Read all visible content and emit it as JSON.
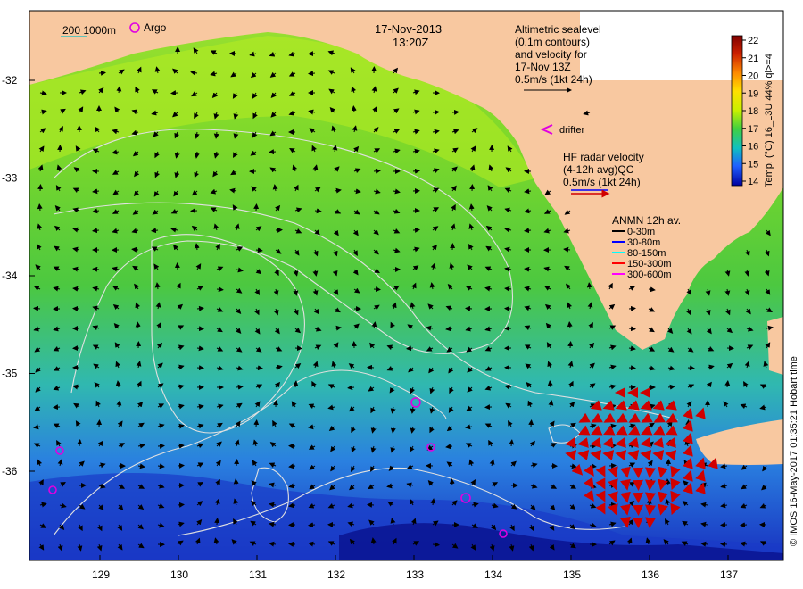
{
  "map": {
    "date": "17-Nov-2013",
    "time": "13:20Z",
    "scale_bar_label": "200  1000m",
    "argo_label": "Argo",
    "altimetry_text": [
      "Altimetric sealevel",
      "(0.1m contours)",
      "and velocity for",
      "17-Nov 13Z",
      "0.5m/s (1kt 24h)"
    ],
    "drifter_label": "drifter",
    "hf_text": [
      "HF radar velocity",
      "(4-12h avg)QC",
      "0.5m/s (1kt 24h)"
    ],
    "anmn_title": "ANMN 12h av.",
    "anmn_items": [
      {
        "label": "0-30m",
        "color": "#000000"
      },
      {
        "label": "30-80m",
        "color": "#0000ff"
      },
      {
        "label": "80-150m",
        "color": "#00ffff"
      },
      {
        "label": "150-300m",
        "color": "#ff0000"
      },
      {
        "label": "300-600m",
        "color": "#ff00ff"
      }
    ],
    "colorbar": {
      "ticks": [
        "22",
        "21",
        "20",
        "19",
        "18",
        "17",
        "16",
        "15",
        "14"
      ],
      "label": "Temp. (°C) 16_L3U 44% ql>=4",
      "stops": [
        "#7f0000",
        "#cc2000",
        "#ff8c00",
        "#ffe000",
        "#c8f000",
        "#40d040",
        "#10c0c0",
        "#2060ff",
        "#0000a0"
      ]
    },
    "credit": "© IMOS 16-May-2017 01:35:21 Hobart time",
    "x_ticks": [
      "129",
      "130",
      "131",
      "132",
      "133",
      "134",
      "135",
      "136",
      "137"
    ],
    "y_ticks": [
      "-32",
      "-33",
      "-34",
      "-35",
      "-36"
    ],
    "colors": {
      "land": "#f8c8a0",
      "arrow": "#000000",
      "hf_arrow": "#d00000",
      "argo": "#e000e0",
      "contour": "#e0e0e0"
    }
  }
}
